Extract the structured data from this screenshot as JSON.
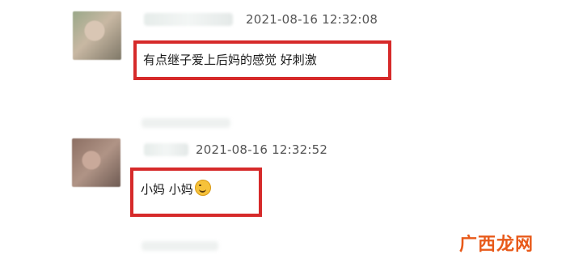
{
  "comments": [
    {
      "timestamp": "2021-08-16 12:32:08",
      "text": "有点继子爱上后妈的感觉 好刺激"
    },
    {
      "timestamp": "2021-08-16 12:32:52",
      "text": "小妈 小妈",
      "emoji": "grinning-face-icon"
    }
  ],
  "colors": {
    "highlight_border": "#d62a2a",
    "watermark": "#e85a1a"
  },
  "watermark": "广西龙网"
}
